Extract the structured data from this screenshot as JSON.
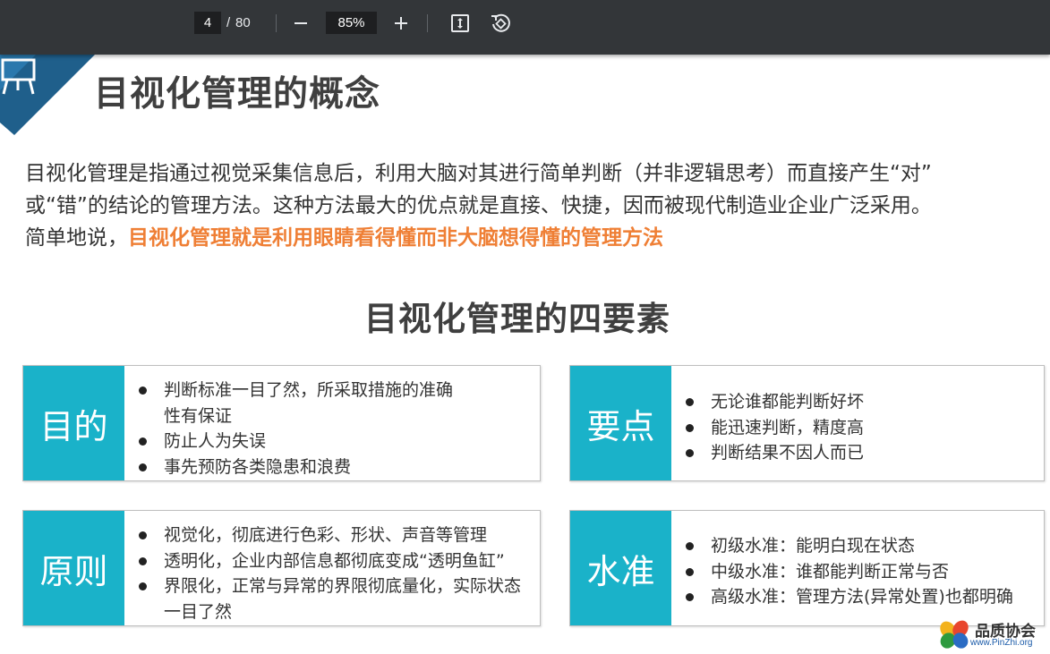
{
  "toolbar": {
    "page_current": "4",
    "page_separator": "/",
    "page_total": "80",
    "zoom": "85%"
  },
  "slide": {
    "title": "目视化管理的概念",
    "paragraph": {
      "line1": "目视化管理是指通过视觉采集信息后，利用大脑对其进行简单判断（并非逻辑思考）而直接产生“对”",
      "line2": "或“错”的结论的管理方法。这种方法最大的优点就是直接、快捷，因而被现代制造业企业广泛采用。",
      "line3_prefix": "简单地说，",
      "line3_highlight": "目视化管理就是利用眼睛看得懂而非大脑想得懂的管理方法"
    },
    "subtitle": "目视化管理的四要素",
    "elements": [
      {
        "label": "目的",
        "bullets": [
          "判断标准一目了然，所采取措施的准确性有保证",
          "防止人为失误",
          "事先预防各类隐患和浪费"
        ]
      },
      {
        "label": "要点",
        "bullets": [
          "无论谁都能判断好坏",
          "能迅速判断，精度高",
          "判断结果不因人而已"
        ]
      },
      {
        "label": "原则",
        "bullets": [
          "视觉化，彻底进行色彩、形状、声音等管理",
          "透明化，企业内部信息都彻底变成“透明鱼缸”",
          "界限化，正常与异常的界限彻底量化，实际状态一目了然"
        ]
      },
      {
        "label": "水准",
        "bullets": [
          "初级水准：能明白现在状态",
          "中级水准：谁都能判断正常与否",
          "高级水准：管理方法(异常处置)也都明确"
        ]
      }
    ],
    "colors": {
      "accent": "#1ab2c9",
      "highlight": "#ef7f35",
      "corner": "#1f5f8b"
    }
  },
  "watermark": {
    "name": "品质协会",
    "url": "www.PinZhi.org"
  }
}
